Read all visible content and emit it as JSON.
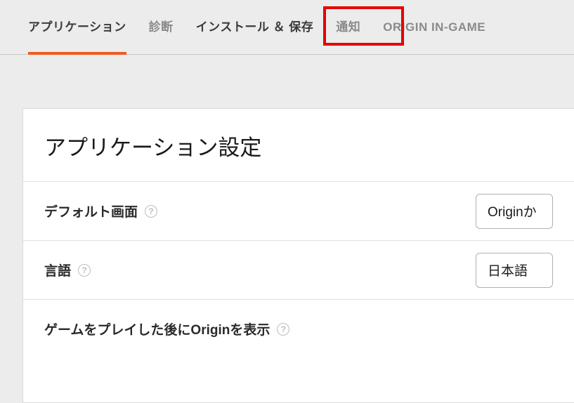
{
  "tabs": {
    "application": "アプリケーション",
    "diagnostics": "診断",
    "install_save": "インストール ＆ 保存",
    "notifications": "通知",
    "origin_in_game": "ORIGIN IN-GAME"
  },
  "panel": {
    "title": "アプリケーション設定"
  },
  "rows": {
    "default_screen": {
      "label": "デフォルト画面",
      "value": "Originか"
    },
    "language": {
      "label": "言語",
      "value": "日本語"
    },
    "show_after_play": {
      "label": "ゲームをプレイした後にOriginを表示"
    }
  },
  "help_glyph": "?"
}
